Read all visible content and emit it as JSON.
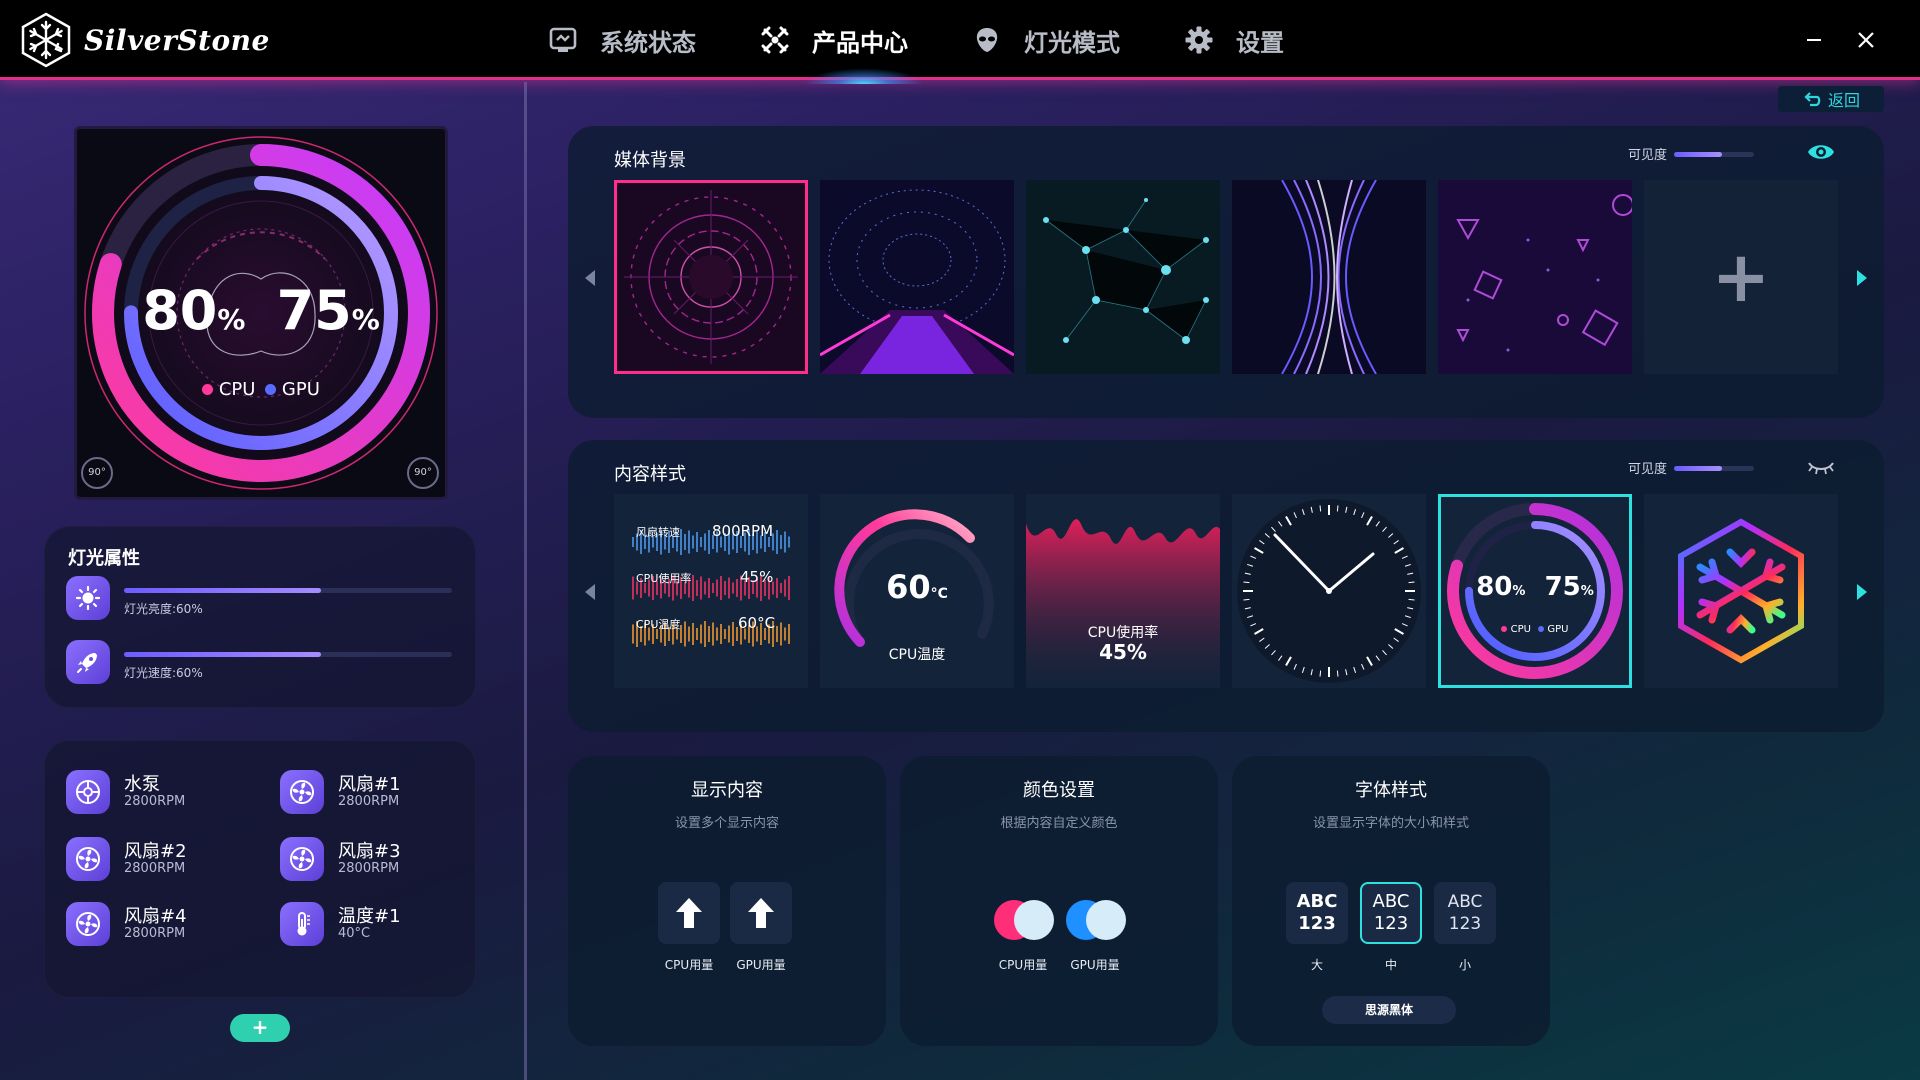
{
  "brand": {
    "name": "SilverStone"
  },
  "nav": {
    "items": [
      {
        "label": "系统状态",
        "icon": "monitor-icon"
      },
      {
        "label": "产品中心",
        "icon": "fan-icon",
        "active": true
      },
      {
        "label": "灯光模式",
        "icon": "alien-icon"
      },
      {
        "label": "设置",
        "icon": "gear-icon"
      }
    ]
  },
  "preview": {
    "cpu_value": "80",
    "gpu_value": "75",
    "unit": "%",
    "cpu_label": "CPU",
    "gpu_label": "GPU",
    "cpu_percent": 80,
    "gpu_percent": 75,
    "rotate_left": "90°",
    "rotate_right": "90°"
  },
  "light_props": {
    "title": "灯光属性",
    "brightness": {
      "label": "灯光亮度:60%",
      "level": 0.6
    },
    "speed": {
      "label": "灯光速度:60%",
      "level": 0.6
    }
  },
  "devices": [
    {
      "name": "水泵",
      "value": "2800RPM",
      "icon": "pump-icon"
    },
    {
      "name": "风扇#1",
      "value": "2800RPM",
      "icon": "fan-icon"
    },
    {
      "name": "风扇#2",
      "value": "2800RPM",
      "icon": "fan-icon"
    },
    {
      "name": "风扇#3",
      "value": "2800RPM",
      "icon": "fan-icon"
    },
    {
      "name": "风扇#4",
      "value": "2800RPM",
      "icon": "fan-icon"
    },
    {
      "name": "温度#1",
      "value": "40°C",
      "icon": "thermometer-icon"
    }
  ],
  "add_device": "+",
  "back": {
    "label": "返回"
  },
  "media": {
    "title": "媒体背景",
    "visibility_label": "可见度",
    "visibility_level": 0.6,
    "add_label": "+"
  },
  "content": {
    "title": "内容样式",
    "visibility_label": "可见度",
    "visibility_level": 0.6,
    "bars_style": {
      "fan_label": "风扇转速",
      "fan_value": "800RPM",
      "cpu_usage_label": "CPU使用率",
      "cpu_usage_value": "45%",
      "cpu_temp_label": "CPU温度",
      "cpu_temp_value": "60°C"
    },
    "temp_style": {
      "value": "60",
      "unit": "°C",
      "label": "CPU温度"
    },
    "usage_style": {
      "label": "CPU使用率",
      "value": "45%"
    },
    "ring_style": {
      "cpu_value": "80",
      "gpu_value": "75",
      "unit": "%",
      "cpu_label": "CPU",
      "gpu_label": "GPU"
    }
  },
  "display_card": {
    "title": "显示内容",
    "subtitle": "设置多个显示内容",
    "options": [
      "CPU用量",
      "GPU用量"
    ]
  },
  "color_card": {
    "title": "颜色设置",
    "subtitle": "根据内容自定义颜色",
    "options": [
      "CPU用量",
      "GPU用量"
    ],
    "colors": {
      "cpu_primary": "#ff2e78",
      "gpu_primary": "#1e90ff",
      "secondary": "#d6ecf8"
    }
  },
  "font_card": {
    "title": "字体样式",
    "subtitle": "设置显示字体的大小和样式",
    "sizes": [
      {
        "line1": "ABC",
        "line2": "123",
        "label": "大"
      },
      {
        "line1": "ABC",
        "line2": "123",
        "label": "中"
      },
      {
        "line1": "ABC",
        "line2": "123",
        "label": "小"
      }
    ],
    "font_name": "思源黑体"
  }
}
